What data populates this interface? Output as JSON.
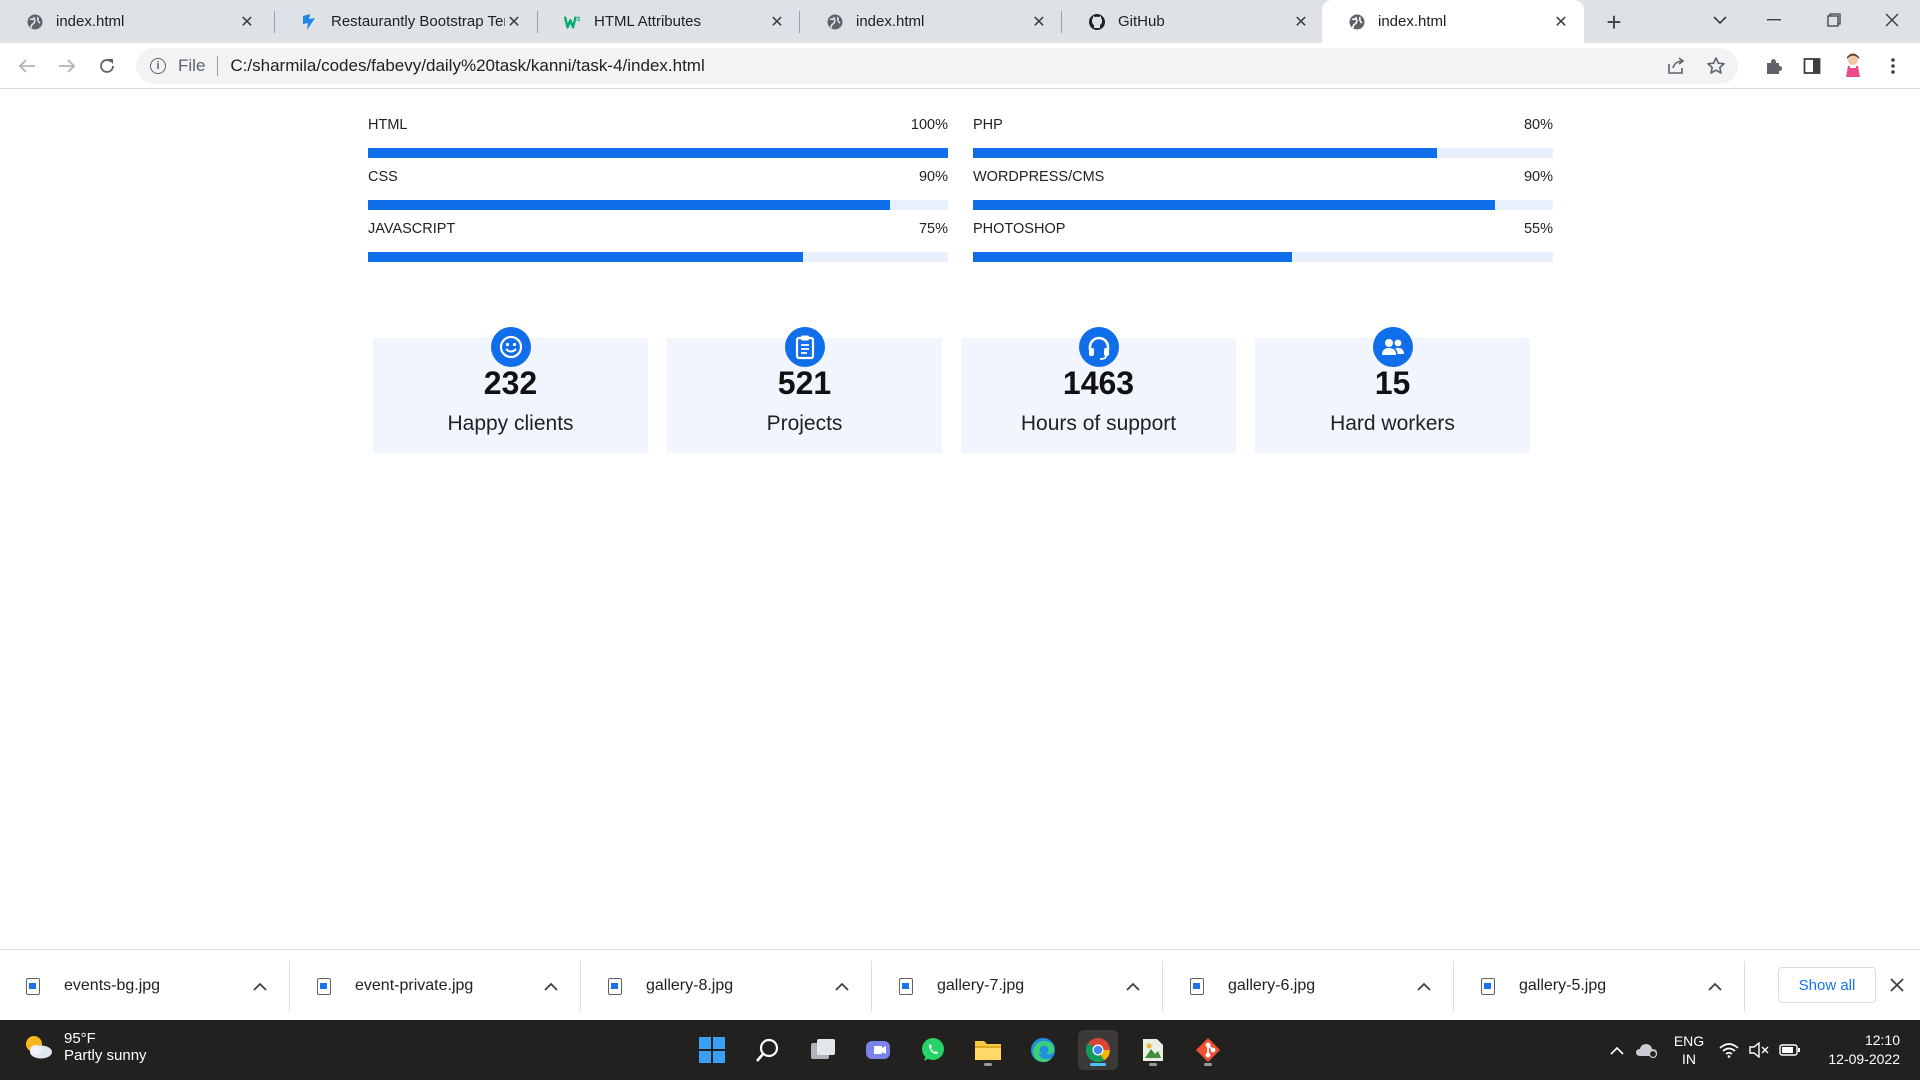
{
  "browser": {
    "tabs": [
      {
        "title": "index.html",
        "icon": "globe-icon"
      },
      {
        "title": "Restaurantly Bootstrap Tem",
        "icon": "bootstrapmade-icon"
      },
      {
        "title": "HTML Attributes",
        "icon": "w3schools-icon"
      },
      {
        "title": "index.html",
        "icon": "globe-icon"
      },
      {
        "title": "GitHub",
        "icon": "github-icon"
      },
      {
        "title": "index.html",
        "icon": "globe-icon"
      }
    ],
    "active_tab": 5,
    "address": {
      "scheme": "File",
      "url": "C:/sharmila/codes/fabevy/daily%20task/kanni/task-4/index.html"
    }
  },
  "skills": {
    "left": [
      {
        "name": "HTML",
        "percent_label": "100%",
        "value": 100
      },
      {
        "name": "CSS",
        "percent_label": "90%",
        "value": 90
      },
      {
        "name": "JAVASCRIPT",
        "percent_label": "75%",
        "value": 75
      }
    ],
    "right": [
      {
        "name": "PHP",
        "percent_label": "80%",
        "value": 80
      },
      {
        "name": "WORDPRESS/CMS",
        "percent_label": "90%",
        "value": 90
      },
      {
        "name": "PHOTOSHOP",
        "percent_label": "55%",
        "value": 55
      }
    ]
  },
  "counts": [
    {
      "number": "232",
      "label": "Happy clients",
      "icon": "smile-icon"
    },
    {
      "number": "521",
      "label": "Projects",
      "icon": "clipboard-icon"
    },
    {
      "number": "1463",
      "label": "Hours of support",
      "icon": "headset-icon"
    },
    {
      "number": "15",
      "label": "Hard workers",
      "icon": "people-icon"
    }
  ],
  "downloads": {
    "items": [
      "events-bg.jpg",
      "event-private.jpg",
      "gallery-8.jpg",
      "gallery-7.jpg",
      "gallery-6.jpg",
      "gallery-5.jpg"
    ],
    "show_all": "Show all"
  },
  "taskbar": {
    "weather": {
      "temp": "95°F",
      "condition": "Partly sunny"
    },
    "language": {
      "lang": "ENG",
      "region": "IN"
    },
    "time": "12:10",
    "date": "12-09-2022"
  },
  "colors": {
    "accent": "#106eea",
    "track": "#e8f0fd",
    "count_bg": "#f1f6fe"
  }
}
